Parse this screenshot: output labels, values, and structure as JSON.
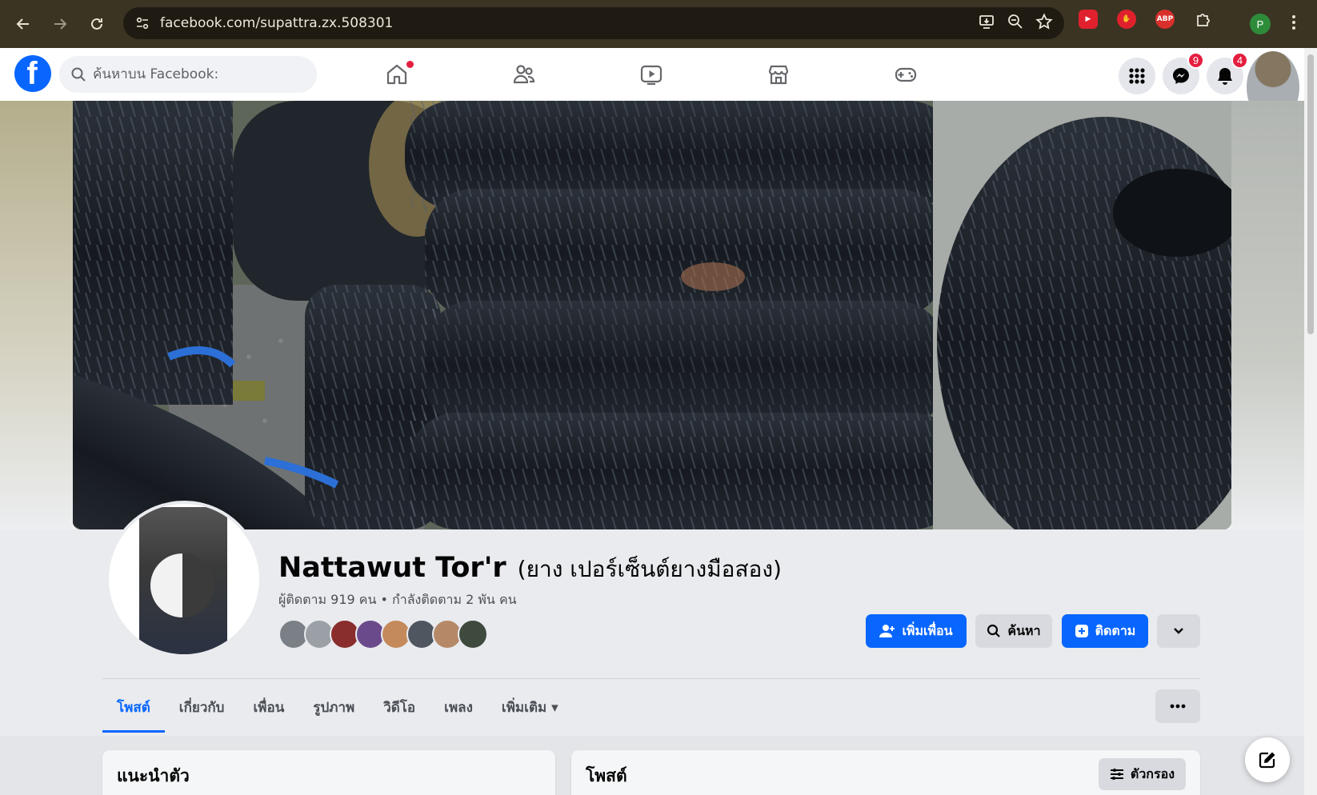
{
  "browser": {
    "url": "facebook.com/supattra.zx.508301",
    "profile_initial": "P",
    "extensions": [
      {
        "name": "youtube-ext-icon",
        "color": "#e0212d",
        "label": ""
      },
      {
        "name": "hand-ext-icon",
        "color": "#e0212d",
        "label": ""
      },
      {
        "name": "abp-ext-icon",
        "color": "#d9302c",
        "label": "ABP"
      },
      {
        "name": "puzzle-ext-icon",
        "color": "transparent",
        "label": ""
      }
    ]
  },
  "fb": {
    "search_placeholder": "ค้นหาบน Facebook:",
    "messenger_badge": "9",
    "notifications_badge": "4",
    "brand_color": "#0866ff"
  },
  "profile": {
    "name": "Nattawut Tor'r",
    "alt_name": "(ยาง เปอร์เซ็นต์ยางมือสอง)",
    "stats": "ผู้ติดตาม 919 คน • กำลังติดตาม 2 พัน คน"
  },
  "actions": {
    "add_friend": "เพิ่มเพื่อน",
    "search": "ค้นหา",
    "follow": "ติดตาม"
  },
  "tabs": [
    {
      "label": "โพสต์",
      "active": true
    },
    {
      "label": "เกี่ยวกับ",
      "active": false
    },
    {
      "label": "เพื่อน",
      "active": false
    },
    {
      "label": "รูปภาพ",
      "active": false
    },
    {
      "label": "วิดีโอ",
      "active": false
    },
    {
      "label": "เพลง",
      "active": false
    },
    {
      "label": "เพิ่มเติม ▾",
      "active": false
    }
  ],
  "intro": {
    "title": "แนะนำตัว"
  },
  "posts": {
    "title": "โพสต์",
    "filter_label": "ตัวกรอง"
  }
}
